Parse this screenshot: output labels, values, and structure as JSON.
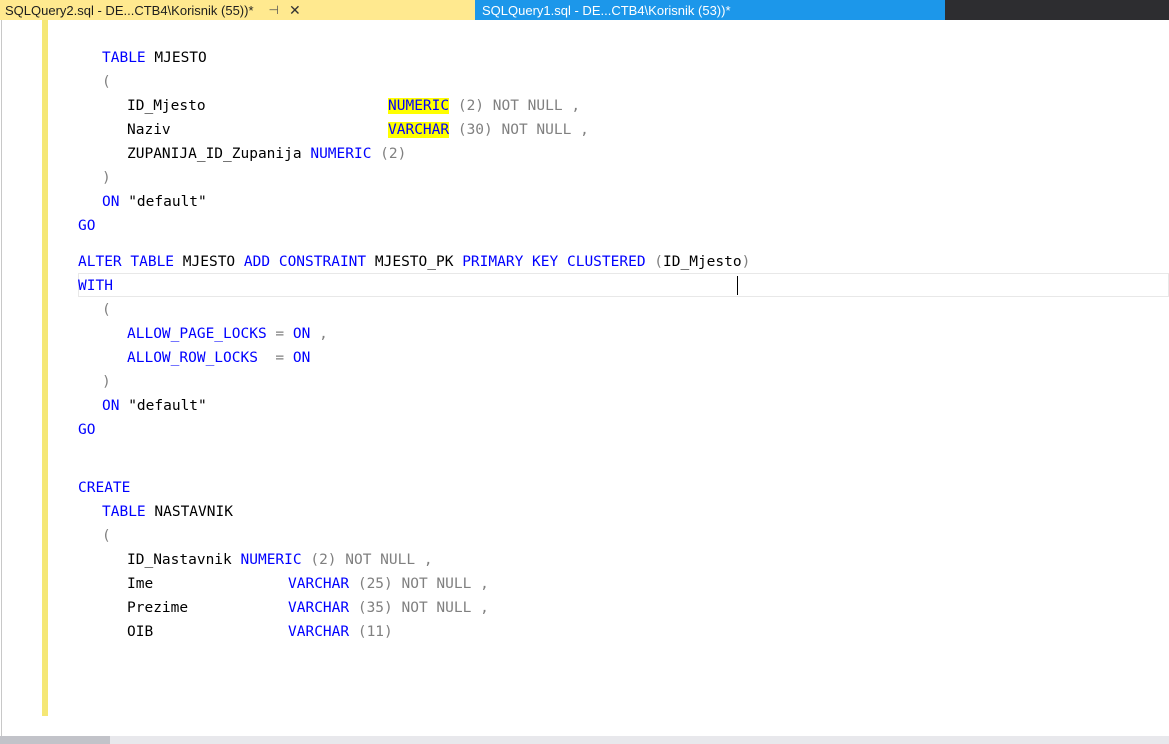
{
  "tabs": [
    {
      "title": "SQLQuery2.sql - DE...CTB4\\Korisnik (55))*",
      "pin": "⊣",
      "close": "✕"
    },
    {
      "title": "SQLQuery1.sql - DE...CTB4\\Korisnik (53))*"
    }
  ],
  "code": {
    "l1": {
      "kw": "TABLE",
      "txt": " MJESTO"
    },
    "l2": {
      "paren": "("
    },
    "l3": {
      "name": "ID_Mjesto",
      "type": "NUMERIC",
      "size": " (2)",
      "rest": " NOT NULL ,"
    },
    "l4": {
      "name": "Naziv",
      "type": "VARCHAR",
      "size": " (30)",
      "rest": " NOT NULL ,"
    },
    "l5": {
      "name": "ZUPANIJA_ID_Zupanija",
      "type": "NUMERIC",
      "size": " (2)"
    },
    "l6": {
      "paren": ")"
    },
    "l7": {
      "kw": "ON",
      "txt": " \"default\""
    },
    "l8": {
      "kw": "GO"
    },
    "l9": {
      "alter": "ALTER",
      "table": "TABLE",
      "name": "MJESTO",
      "add": "ADD",
      "constraint": "CONSTRAINT",
      "pk": "MJESTO_PK",
      "primary": "PRIMARY",
      "key": "KEY",
      "clustered": "CLUSTERED",
      "open": "(",
      "col": "ID_Mjesto",
      "close": ")"
    },
    "l10": {
      "kw": "WITH"
    },
    "l11": {
      "paren": "("
    },
    "l12": {
      "opt": "ALLOW_PAGE_LOCKS",
      "eq": " = ",
      "val": "ON",
      "sep": " ,"
    },
    "l13": {
      "opt": "ALLOW_ROW_LOCKS",
      "eq": "  = ",
      "val": "ON"
    },
    "l14": {
      "paren": ")"
    },
    "l15": {
      "kw": "ON",
      "txt": " \"default\""
    },
    "l16": {
      "kw": "GO"
    },
    "l17": {
      "kw": "CREATE"
    },
    "l18": {
      "kw": "TABLE",
      "txt": " NASTAVNIK"
    },
    "l19": {
      "paren": "("
    },
    "l20": {
      "name": "ID_Nastavnik",
      "type": "NUMERIC",
      "size": " (2)",
      "rest": " NOT NULL ,"
    },
    "l21": {
      "name": "Ime",
      "type": "VARCHAR",
      "size": " (25)",
      "rest": " NOT NULL ,"
    },
    "l22": {
      "name": "Prezime",
      "type": "VARCHAR",
      "size": " (35)",
      "rest": " NOT NULL ,"
    },
    "l23": {
      "name": "OIB",
      "type": "VARCHAR",
      "size": " (11)"
    }
  }
}
